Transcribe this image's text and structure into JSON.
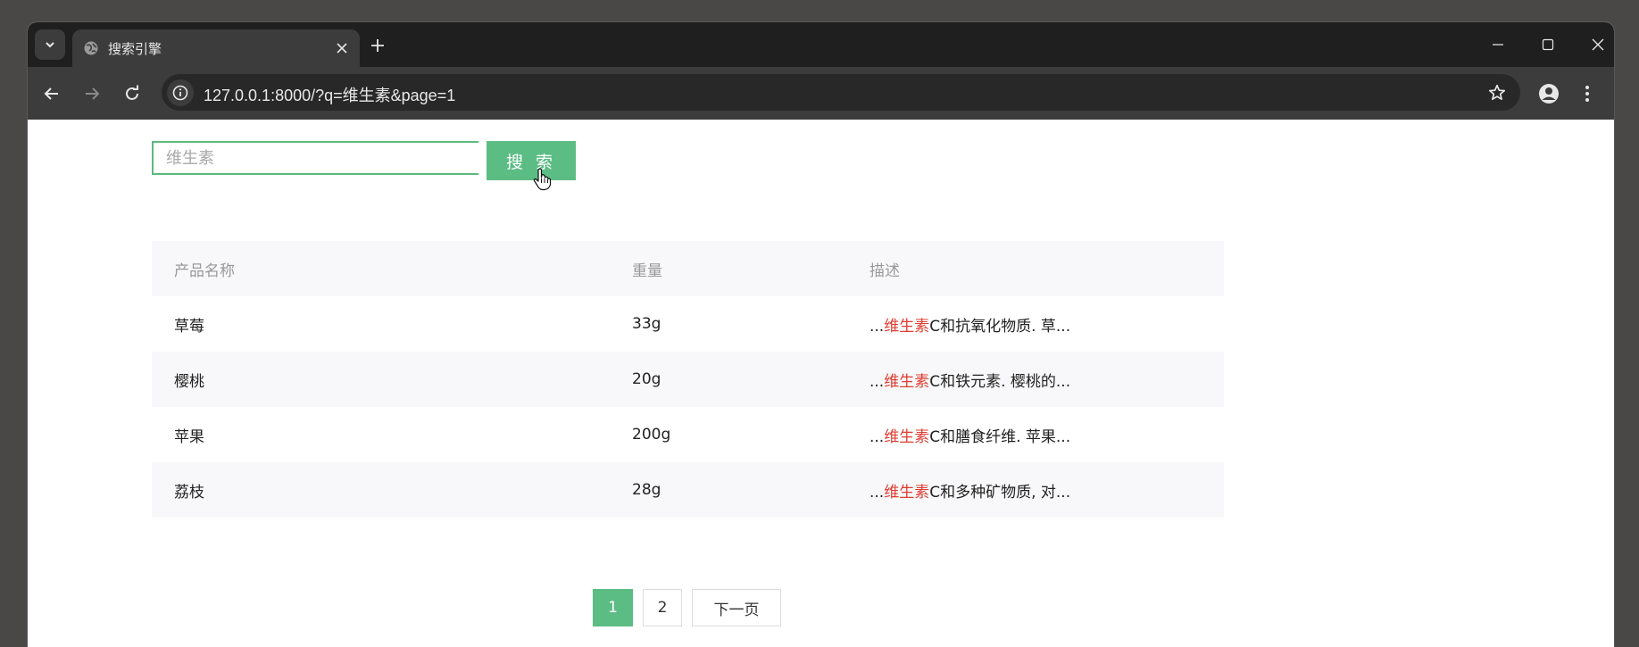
{
  "browser": {
    "tab_title": "搜索引擎",
    "url": "127.0.0.1:8000/?q=维生素&page=1"
  },
  "search": {
    "value": "",
    "placeholder": "维生素",
    "button_label": "搜 索"
  },
  "table": {
    "headers": [
      "产品名称",
      "重量",
      "描述"
    ],
    "rows": [
      {
        "name": "草莓",
        "weight": "33g",
        "desc_prefix": "...",
        "desc_highlight": "维生素",
        "desc_rest": "C和抗氧化物质. 草..."
      },
      {
        "name": "樱桃",
        "weight": "20g",
        "desc_prefix": "...",
        "desc_highlight": "维生素",
        "desc_rest": "C和铁元素. 樱桃的..."
      },
      {
        "name": "苹果",
        "weight": "200g",
        "desc_prefix": "...",
        "desc_highlight": "维生素",
        "desc_rest": "C和膳食纤维. 苹果..."
      },
      {
        "name": "荔枝",
        "weight": "28g",
        "desc_prefix": "...",
        "desc_highlight": "维生素",
        "desc_rest": "C和多种矿物质, 对..."
      }
    ]
  },
  "pagination": {
    "pages": [
      "1",
      "2"
    ],
    "current": "1",
    "next_label": "下一页"
  },
  "colors": {
    "accent": "#5cbd84",
    "highlight": "#e03c31"
  }
}
